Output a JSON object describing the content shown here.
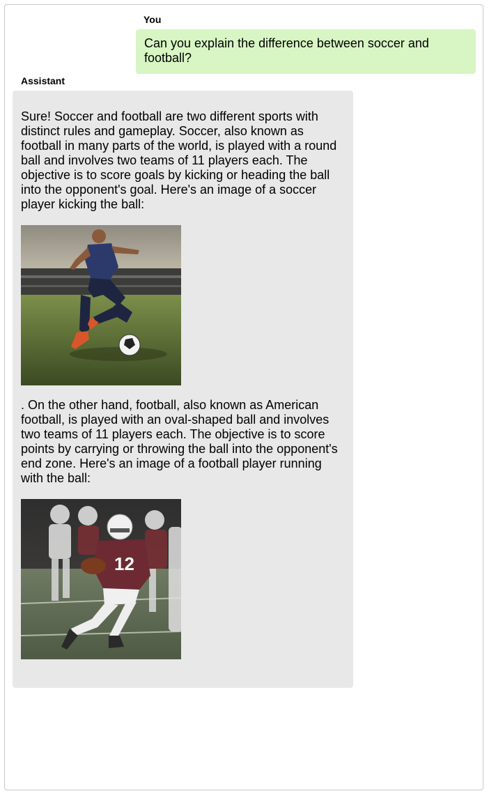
{
  "conversation": {
    "user_label": "You",
    "assistant_label": "Assistant",
    "user_message": "Can you explain the difference between soccer and football?",
    "assistant_paragraph_1": "Sure! Soccer and football are two different sports with distinct rules and gameplay. Soccer, also known as football in many parts of the world, is played with a round ball and involves two teams of 11 players each. The objective is to score goals by kicking or heading the ball into the opponent's goal. Here's an image of a soccer player kicking the ball:",
    "assistant_paragraph_2": ". On the other hand, football, also known as American football, is played with an oval-shaped ball and involves two teams of 11 players each. The objective is to score points by carrying or throwing the ball into the opponent's end zone. Here's an image of a football player running with the ball:"
  },
  "images": {
    "soccer_player": "soccer-player-kicking-ball",
    "football_player": "football-player-running-with-ball",
    "football_jersey_number": "12"
  },
  "colors": {
    "user_bubble": "#d8f5c4",
    "assistant_bubble": "#e8e8e8"
  }
}
